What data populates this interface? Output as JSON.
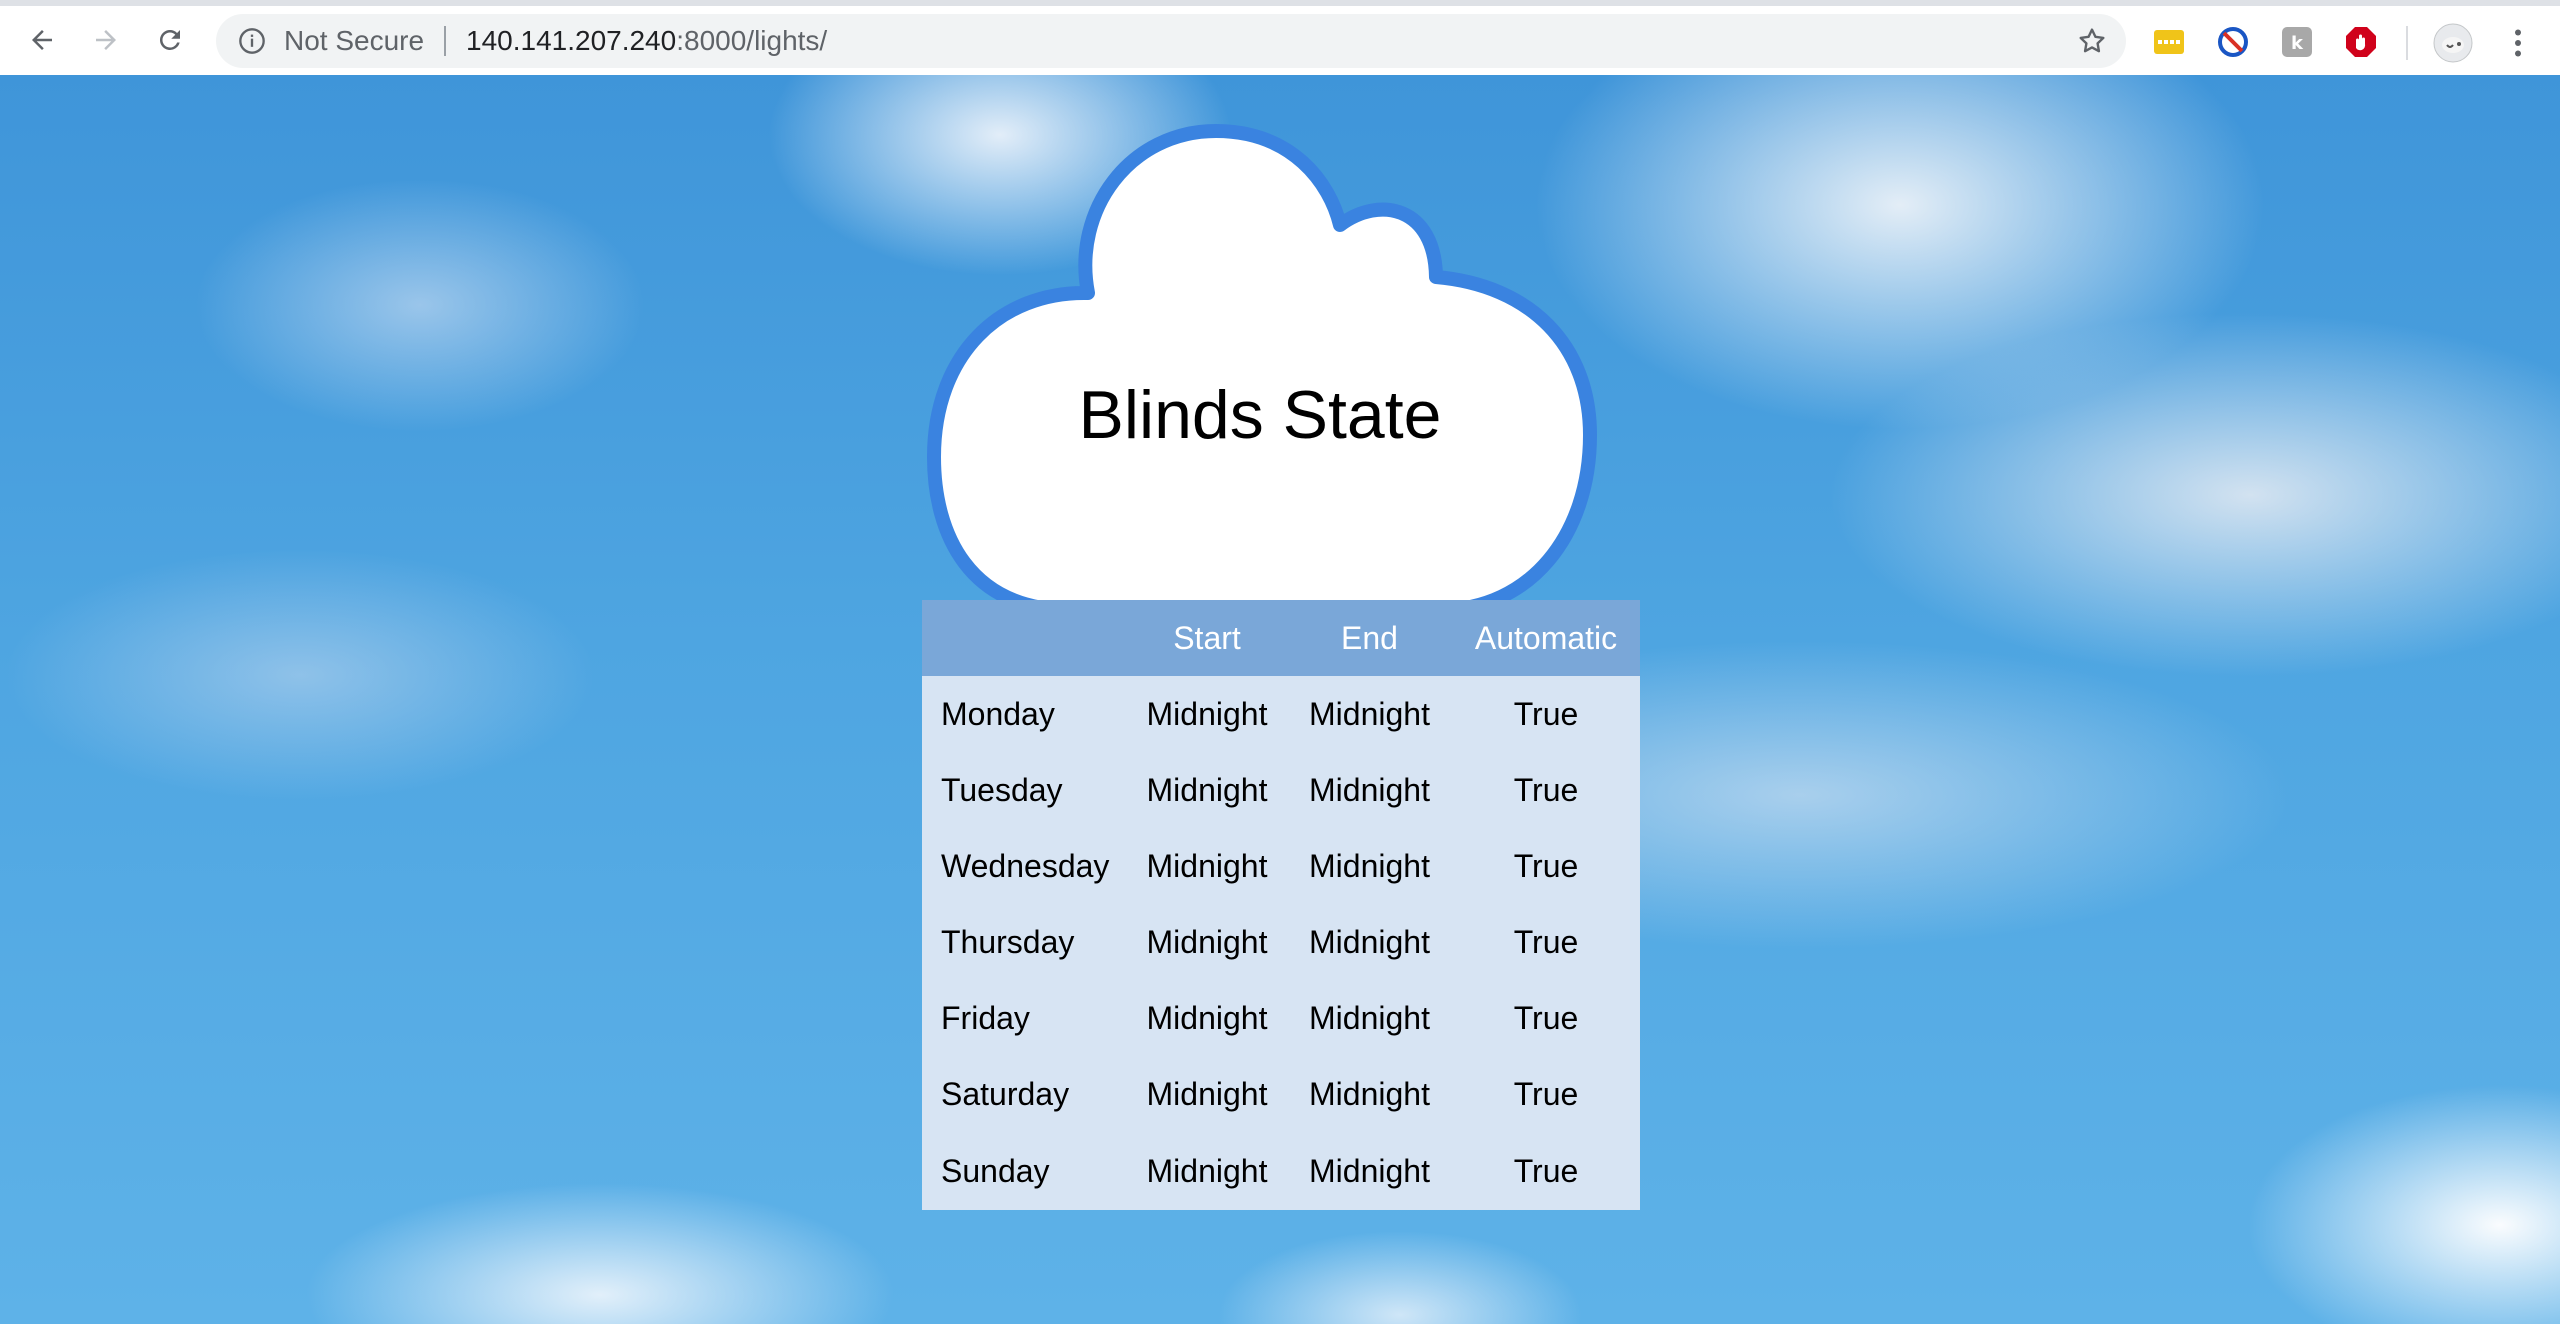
{
  "browser": {
    "security_label": "Not Secure",
    "url_host": "140.141.207.240",
    "url_path": ":8000/lights/",
    "icons": [
      "back-arrow-icon",
      "forward-arrow-icon",
      "reload-icon",
      "info-icon",
      "star-icon",
      "extension-password-icon",
      "extension-block-icon",
      "extension-k-icon",
      "extension-adblock-icon",
      "profile-avatar-icon",
      "more-vert-icon"
    ]
  },
  "page": {
    "title": "Blinds State"
  },
  "schedule": {
    "headers": [
      "",
      "Start",
      "End",
      "Automatic"
    ],
    "rows": [
      {
        "day": "Monday",
        "start": "Midnight",
        "end": "Midnight",
        "automatic": "True"
      },
      {
        "day": "Tuesday",
        "start": "Midnight",
        "end": "Midnight",
        "automatic": "True"
      },
      {
        "day": "Wednesday",
        "start": "Midnight",
        "end": "Midnight",
        "automatic": "True"
      },
      {
        "day": "Thursday",
        "start": "Midnight",
        "end": "Midnight",
        "automatic": "True"
      },
      {
        "day": "Friday",
        "start": "Midnight",
        "end": "Midnight",
        "automatic": "True"
      },
      {
        "day": "Saturday",
        "start": "Midnight",
        "end": "Midnight",
        "automatic": "True"
      },
      {
        "day": "Sunday",
        "start": "Midnight",
        "end": "Midnight",
        "automatic": "True"
      }
    ]
  },
  "colors": {
    "cloud_outline": "#3a83e0",
    "table_header": "#7aa7d8",
    "table_body": "#d7e4f3"
  }
}
